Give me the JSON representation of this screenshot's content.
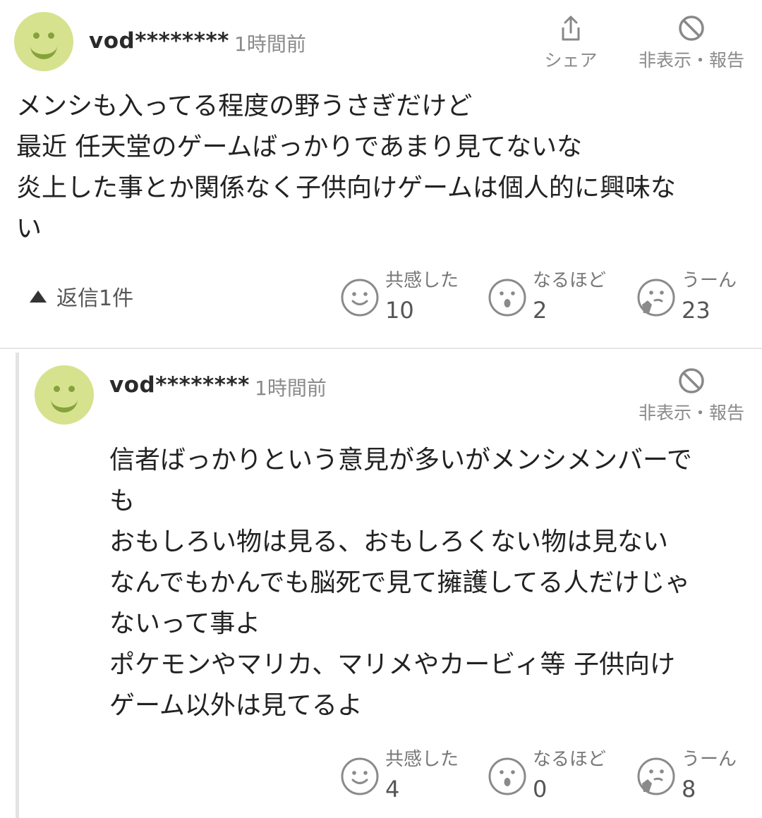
{
  "comment": {
    "username": "vod********",
    "time": "1時間前",
    "share_label": "シェア",
    "report_label": "非表示・報告",
    "body": "メンシも入ってる程度の野うさぎだけど\n最近 任天堂のゲームばっかりであまり見てないな\n炎上した事とか関係なく子供向けゲームは個人的に興味な\nい",
    "replies_label": "返信1件",
    "reactions": {
      "empathy": {
        "label": "共感した",
        "count": "10"
      },
      "insight": {
        "label": "なるほど",
        "count": "2"
      },
      "hmm": {
        "label": "うーん",
        "count": "23"
      }
    }
  },
  "reply": {
    "username": "vod********",
    "time": "1時間前",
    "report_label": "非表示・報告",
    "body": "信者ばっかりという意見が多いがメンシメンバーで\nも\nおもしろい物は見る、おもしろくない物は見ない\nなんでもかんでも脳死で見て擁護してる人だけじゃ\nないって事よ\nポケモンやマリカ、マリメやカービィ等 子供向け\nゲーム以外は見てるよ",
    "reactions": {
      "empathy": {
        "label": "共感した",
        "count": "4"
      },
      "insight": {
        "label": "なるほど",
        "count": "0"
      },
      "hmm": {
        "label": "うーん",
        "count": "8"
      }
    }
  },
  "colors": {
    "avatar_bg": "#d7e28f",
    "avatar_face": "#86a23a",
    "muted": "#8a8a8a"
  },
  "icons": [
    "smile-avatar-icon",
    "share-icon",
    "block-icon",
    "smile-face-icon",
    "surprised-face-icon",
    "thinking-face-icon",
    "triangle-up-icon"
  ]
}
